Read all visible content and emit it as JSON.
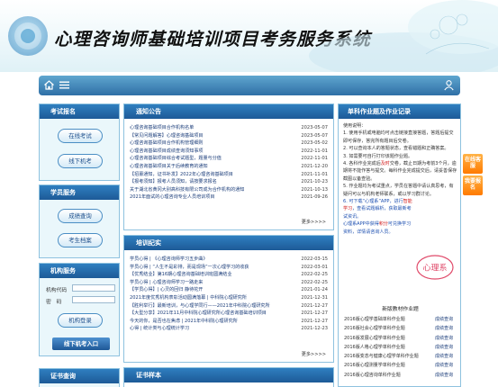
{
  "header": {
    "title": "心理咨询师基础培训项目考务服务系统"
  },
  "left": {
    "exam_signup": {
      "title": "考试报名",
      "btn_online": "在线考试",
      "btn_offline": "线下机考"
    },
    "student": {
      "title": "学员服务",
      "btn_score": "成绩查询",
      "btn_archive": "考生档案"
    },
    "org": {
      "title": "机构服务",
      "label_code": "机构代码",
      "label_pwd": "密　码",
      "btn_login": "机构登录",
      "btn_offline_entry": "线下机考入口"
    },
    "cert": {
      "title": "证书查询"
    }
  },
  "notice": {
    "title": "通知公告",
    "more": "更多>>>>",
    "items": [
      {
        "title": "心理咨询基础项目合作机构名单",
        "date": "2023-05-07"
      },
      {
        "title": "【常见问题解答】心理咨询基础项目",
        "date": "2023-05-07"
      },
      {
        "title": "心理咨询基础项目合作机构管理细则",
        "date": "2023-05-02"
      },
      {
        "title": "心理咨询基础项目成绩查询须知事项",
        "date": "2022-11-01"
      },
      {
        "title": "心理咨询基础项目综合考试题型，题量与分值",
        "date": "2022-11-01"
      },
      {
        "title": "心理咨询基础项目关于后续教育的通知",
        "date": "2021-12-20"
      },
      {
        "title": "【招募通知，证书补发】2022年心理咨询基础项目",
        "date": "2021-11-01"
      },
      {
        "title": "【报考须知】报考人员须知，请按要求报名",
        "date": "2021-10-23"
      },
      {
        "title": "关于湖北省黄冈大别高科技有限公司成为合作机构的通知",
        "date": "2021-10-13"
      },
      {
        "title": "2021年面试的心理咨询专业人员培训项目",
        "date": "2021-09-26"
      }
    ]
  },
  "training": {
    "title": "培训纪实",
    "more": "更多>>>>",
    "items": [
      {
        "title": "学员心得 | 《心理咨询师学习五步曲》",
        "date": "2022-03-15"
      },
      {
        "title": "学员心得 | “人生不是彩排，而是现场”一次心理学习的收获",
        "date": "2022-03-01"
      },
      {
        "title": "【优秀结业】第16期心理咨询基础培训班圆满结业",
        "date": "2022-02-25"
      },
      {
        "title": "学员心得 | 心理咨询师学习一路走来",
        "date": "2022-02-25"
      },
      {
        "title": "【学员心得】| 心灵的回归 静待花开",
        "date": "2021-01-24"
      },
      {
        "title": "2021年度优秀机构表彰活动圆满落幕 | 中科院心理研究所",
        "date": "2021-12-31"
      },
      {
        "title": "【胜利举行】最新培训，与心理学同行——2021年中科院心理研究所",
        "date": "2021-12-27"
      },
      {
        "title": "【大型分享】2021年11月中科院心理研究所心理咨询基础培训项目",
        "date": "2021-12-27"
      },
      {
        "title": "今天的你，是否也在焦虑 | 2021年中科院心理研究所",
        "date": "2021-12-27"
      },
      {
        "title": "心得 | 统计类与心理统计学习",
        "date": "2021-12-23"
      }
    ]
  },
  "cert_sample": {
    "title": "证书样本"
  },
  "sidetabs": {
    "tab1": "在线客服",
    "tab2": "我要报名"
  },
  "right": {
    "title": "单科作业题及作业记录",
    "guide": {
      "heading": "使用说明：",
      "p1": "1. 使用手机或电脑均可点击链接直接答题，答题后提交即可保存，答完所有题目后交卷。",
      "p2": "2. 可以查询本人的答题状态，查看错题和正确答案。",
      "p3": "3. 如需要可自行打印该题作业题。",
      "p4_a": "4. 各科作业完成后",
      "p4_red": "及时",
      "p4_b": "交卷，截止日期为考前3个月，逾期将不能作答与提交。每科作业完成提交后，请妥善保存截图以备查验。",
      "p5": "5. 作业题均为考试重点，学员在答题中请认真思考，有疑问可以与机构老师联系，或以学习群讨论。",
      "p6_a": "6. 可下载“心理系”APP，进行",
      "p6_blue": "智能学习",
      "p6_b": "，查看试题解析，获取最新考试资讯。",
      "p7_a": "心理系APP中获得",
      "p7_red": "积分",
      "p7_b": "可兑换学习资料，详情请咨询人员。"
    },
    "stamp": "心理系",
    "books_title": "新版教材作业题",
    "books": [
      {
        "name": "2016版心理学基础单科作业题",
        "q": "成绩查询"
      },
      {
        "name": "2016版社会心理学单科作业题",
        "q": "成绩查询"
      },
      {
        "name": "2016版发展心理学单科作业题",
        "q": "成绩查询"
      },
      {
        "name": "2016版人格心理学单科作业题",
        "q": "成绩查询"
      },
      {
        "name": "2016版变态与健康心理学单科作业题",
        "q": "成绩查询"
      },
      {
        "name": "2016版心理测量学单科作业题",
        "q": "成绩查询"
      },
      {
        "name": "2016版心理咨询单科作业题",
        "q": "成绩查询"
      }
    ]
  }
}
